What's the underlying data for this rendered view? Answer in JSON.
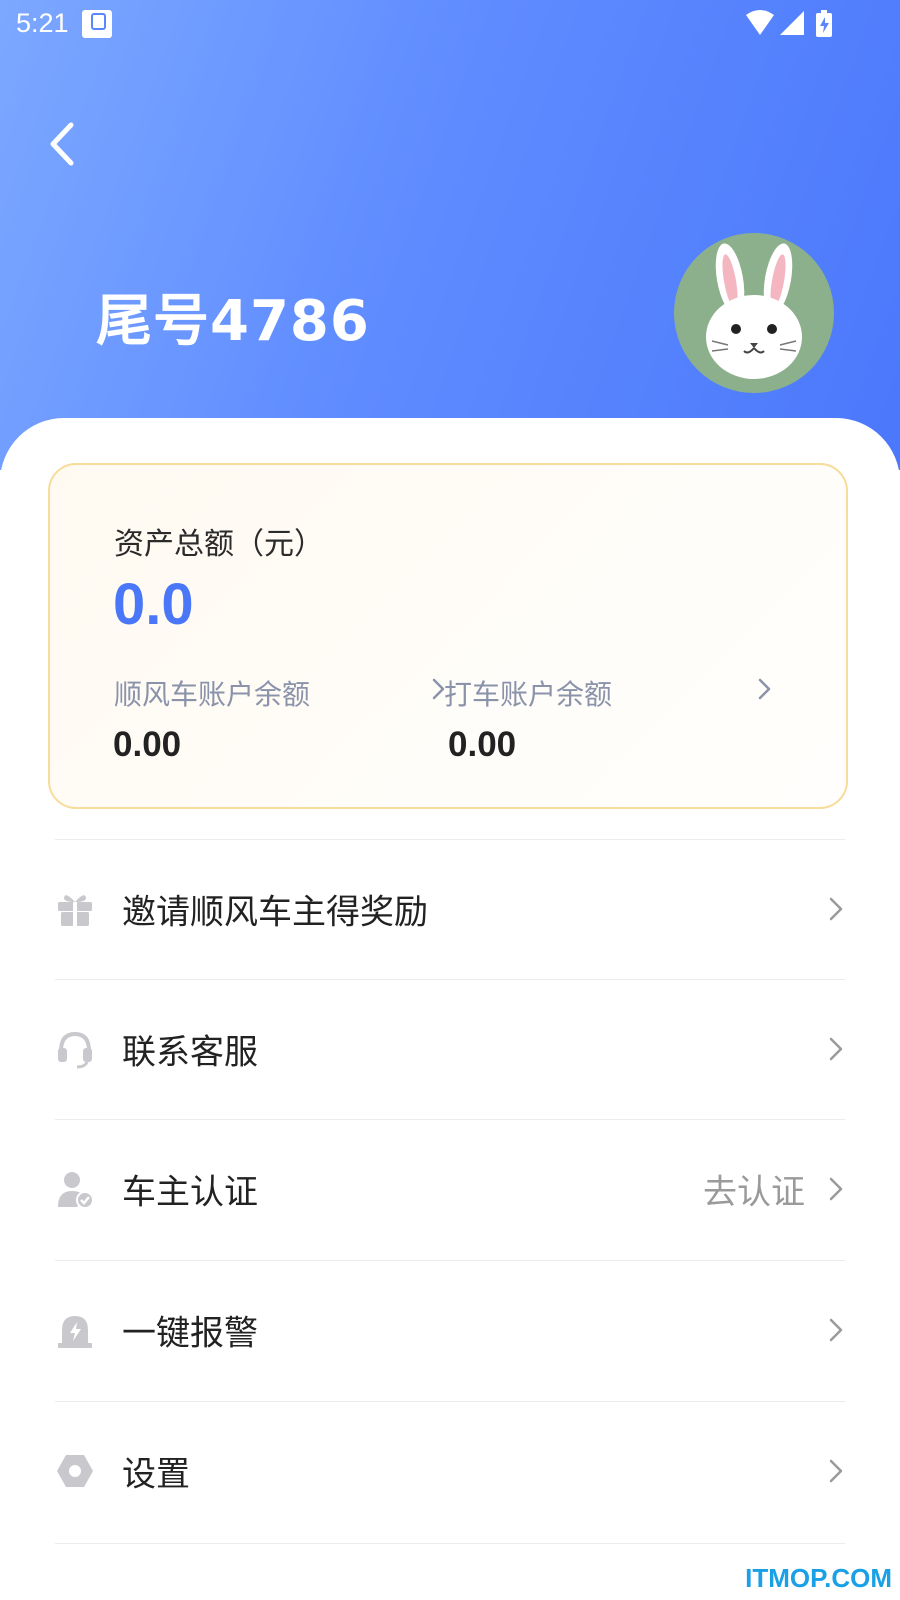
{
  "status_bar": {
    "time": "5:21",
    "icons": [
      "notification-app-icon",
      "wifi-icon",
      "signal-icon",
      "battery-charging-icon"
    ]
  },
  "header": {
    "back_icon": "chevron-left-icon",
    "title": "尾号4786",
    "avatar": "rabbit-avatar"
  },
  "assets": {
    "title": "资产总额（元）",
    "total": "0.0",
    "accounts": [
      {
        "label": "顺风车账户余额",
        "value": "0.00"
      },
      {
        "label": "打车账户余额",
        "value": "0.00"
      }
    ]
  },
  "menu": [
    {
      "icon": "gift-icon",
      "label": "邀请顺风车主得奖励",
      "extra": ""
    },
    {
      "icon": "headset-icon",
      "label": "联系客服",
      "extra": ""
    },
    {
      "icon": "driver-verify-icon",
      "label": "车主认证",
      "extra": "去认证"
    },
    {
      "icon": "alarm-icon",
      "label": "一键报警",
      "extra": ""
    },
    {
      "icon": "settings-icon",
      "label": "设置",
      "extra": ""
    }
  ],
  "colors": {
    "header_gradient": [
      "#7ca8ff",
      "#4b78fb"
    ],
    "accent": "#4a77f8",
    "card_border": "#f7dc9a",
    "icon_gray": "#c9c9cd"
  },
  "watermark": "ITMOP.COM"
}
